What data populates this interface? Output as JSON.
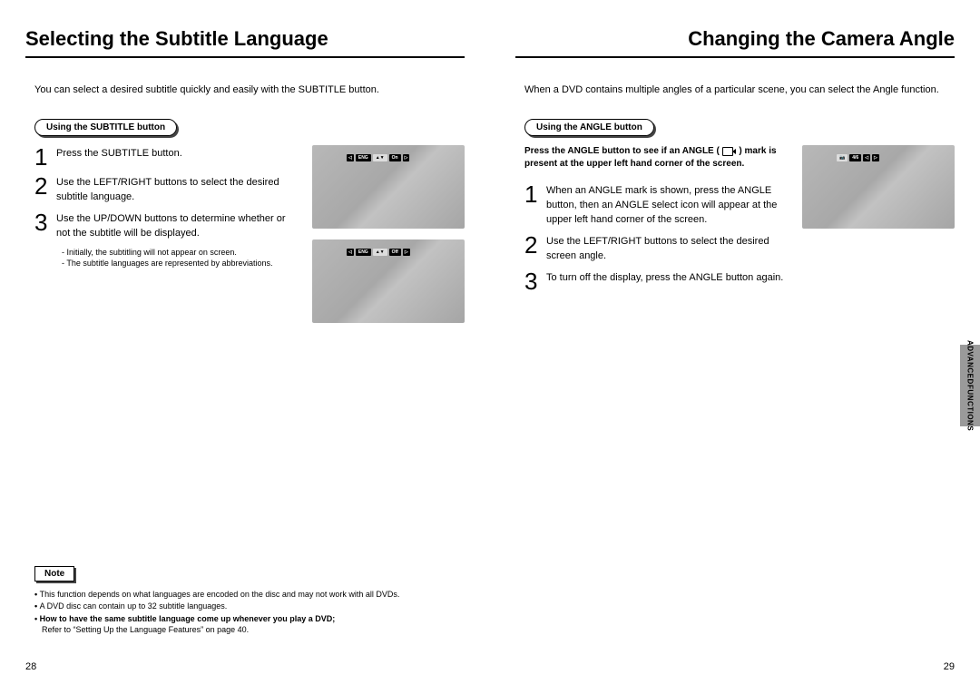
{
  "left": {
    "title": "Selecting the Subtitle Language",
    "intro": "You can select a desired subtitle quickly and easily with the SUBTITLE button.",
    "pill": "Using the SUBTITLE button",
    "steps": [
      "Press the SUBTITLE button.",
      "Use the LEFT/RIGHT buttons to select the desired subtitle language.",
      "Use the UP/DOWN buttons to determine whether or not the subtitle will be displayed."
    ],
    "bullets": [
      "Initially, the subtitling will not appear on screen.",
      "The subtitle languages are represented by abbreviations."
    ],
    "osd1": {
      "lang": "ENG",
      "state": "On"
    },
    "osd2": {
      "lang": "ENG",
      "state": "Off"
    },
    "noteLabel": "Note",
    "notes": {
      "n1": "This function depends on what languages are encoded on the disc and may not work with all DVDs.",
      "n2": "A DVD disc can contain up to 32 subtitle languages.",
      "n3": "How to have the same subtitle language come up whenever you play a DVD;",
      "n3sub": "Refer to “Setting Up the Language Features” on page 40."
    },
    "pageNum": "28"
  },
  "right": {
    "title": "Changing the Camera Angle",
    "intro": "When a DVD contains multiple angles of a particular scene, you can select the Angle function.",
    "pill": "Using the ANGLE button",
    "boldPre": "Press the ANGLE button to see if an ANGLE (",
    "boldPost": ") mark is present at the upper left hand corner of the screen.",
    "steps": [
      "When an ANGLE mark is shown, press the ANGLE button, then an ANGLE select icon will appear at the upper left hand corner of the screen.",
      "Use the LEFT/RIGHT buttons to select the desired screen angle.",
      "To turn off the display, press the ANGLE button again."
    ],
    "osd": {
      "value": "4/6"
    },
    "pageNum": "29",
    "tab1": "ADVANCED",
    "tab2": "FUNCTIONS"
  }
}
